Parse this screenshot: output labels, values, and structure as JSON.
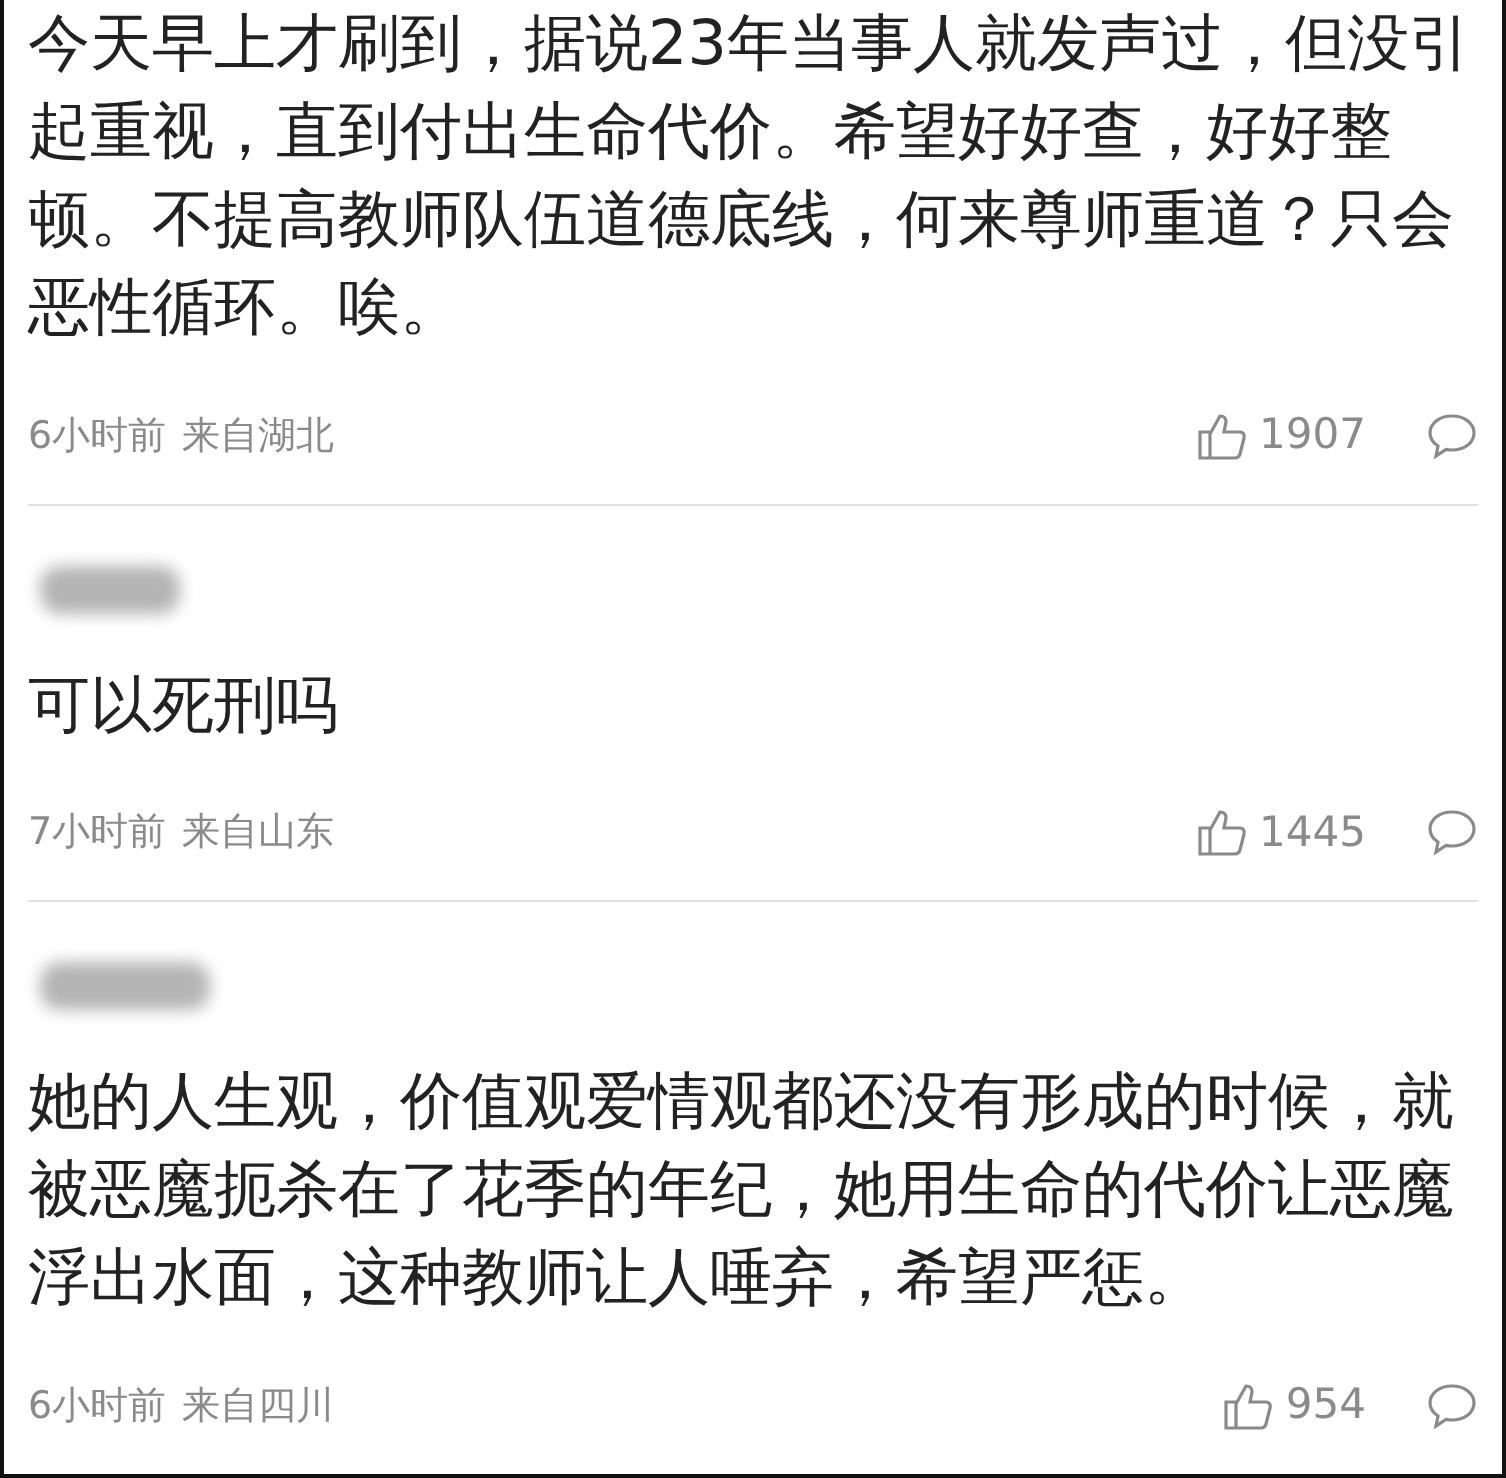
{
  "comments": [
    {
      "show_username": false,
      "text": "今天早上才刷到，据说23年当事人就发声过，但没引起重视，直到付出生命代价。希望好好查，好好整顿。不提高教师队伍道德底线，何来尊师重道？只会恶性循环。唉。",
      "time": "6小时前",
      "location": "来自湖北",
      "likes": "1907"
    },
    {
      "show_username": true,
      "text": "可以死刑吗",
      "time": "7小时前",
      "location": "来自山东",
      "likes": "1445"
    },
    {
      "show_username": true,
      "text": "她的人生观，价值观爱情观都还没有形成的时候，就被恶魔扼杀在了花季的年纪，她用生命的代价让恶魔浮出水面，这种教师让人唾弃，希望严惩。",
      "time": "6小时前",
      "location": "来自四川",
      "likes": "954"
    }
  ]
}
